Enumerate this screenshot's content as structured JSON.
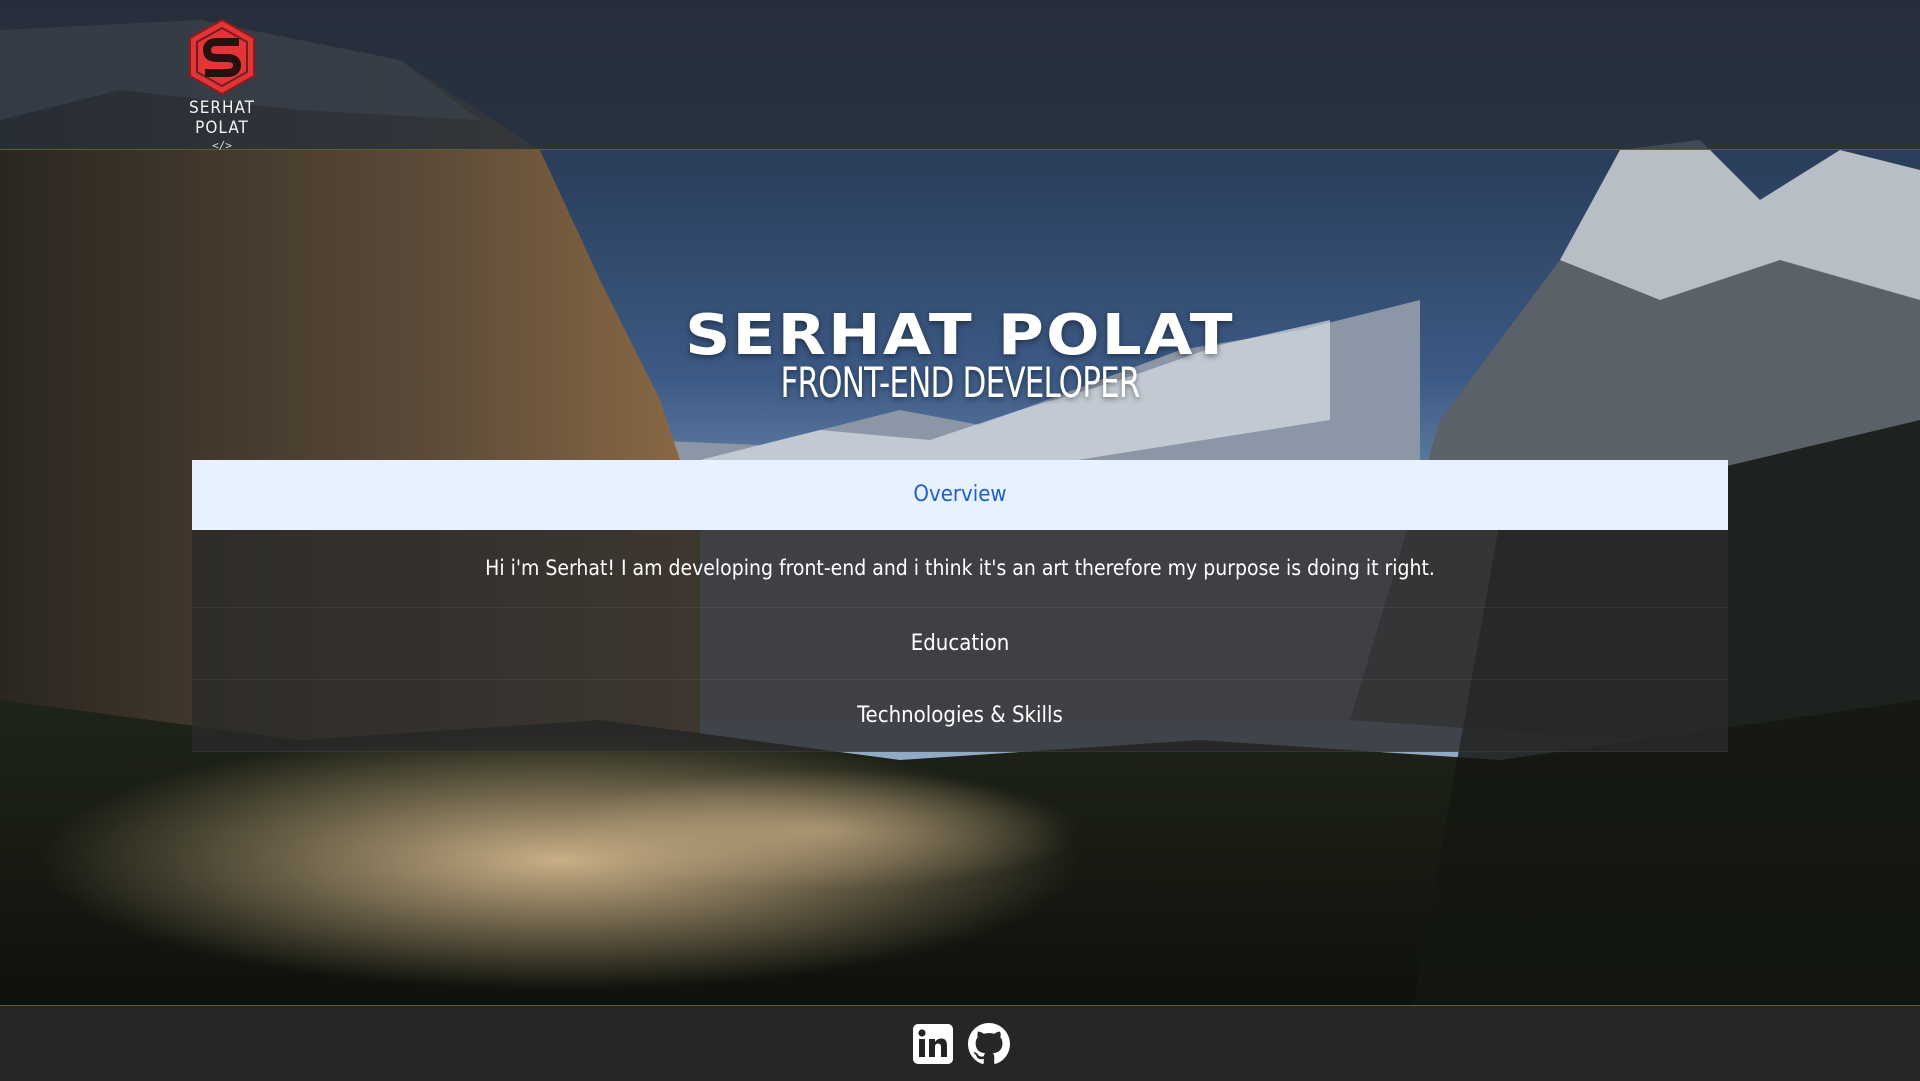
{
  "colors": {
    "accent_red": "#c8282d",
    "accordion_open_bg": "#e7f1ff",
    "accordion_open_text": "#1f5fc9",
    "panel_bg": "rgba(42,42,42,0.80)"
  },
  "header": {
    "logo": {
      "icon": "s-hexagon-logo-icon",
      "name": "SERHAT POLAT",
      "tag": "</>"
    }
  },
  "hero": {
    "title": "SERHAT POLAT",
    "subtitle": "FRONT-END DEVELOPER"
  },
  "accordion": {
    "items": [
      {
        "label": "Overview",
        "expanded": true,
        "content": "Hi i'm Serhat! I am developing front-end and i think it's an art therefore my purpose is doing it right."
      },
      {
        "label": "Education",
        "expanded": false
      },
      {
        "label": "Technologies & Skills",
        "expanded": false
      }
    ]
  },
  "footer": {
    "social": [
      {
        "icon": "linkedin-icon"
      },
      {
        "icon": "github-icon"
      }
    ]
  }
}
